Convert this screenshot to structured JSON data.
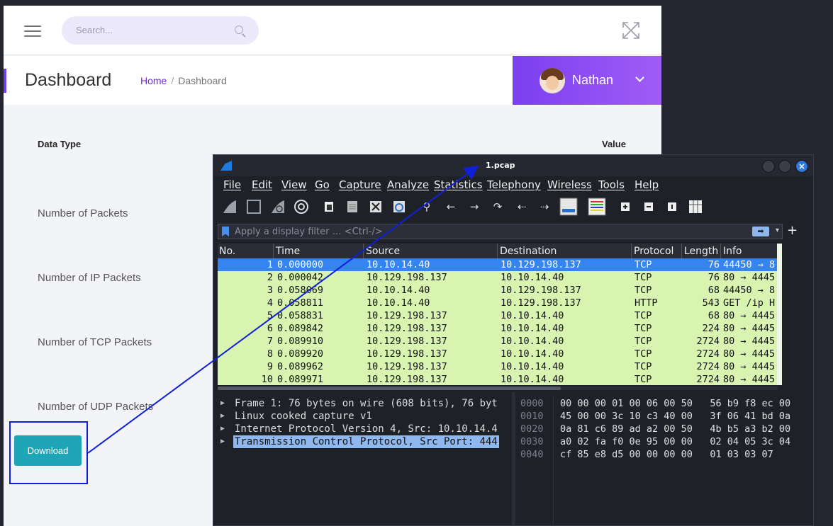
{
  "dashboard": {
    "search_placeholder": "Search...",
    "page_title": "Dashboard",
    "breadcrumb": {
      "home": "Home",
      "separator": "/",
      "current": "Dashboard"
    },
    "user": {
      "name": "Nathan"
    },
    "table": {
      "col_type": "Data Type",
      "col_value": "Value",
      "rows": [
        "Number of Packets",
        "Number of IP Packets",
        "Number of TCP Packets",
        "Number of UDP Packets"
      ]
    },
    "download_label": "Download",
    "colors": {
      "accent": "#6f3ff2",
      "user_gradient_start": "#7b3ff0",
      "download": "#1fa6b6",
      "annotation": "#1020d8"
    }
  },
  "wireshark": {
    "window_title": "1.pcap",
    "menu": [
      "File",
      "Edit",
      "View",
      "Go",
      "Capture",
      "Analyze",
      "Statistics",
      "Telephony",
      "Wireless",
      "Tools",
      "Help"
    ],
    "toolbar_icons": [
      "shark-fin-start-icon",
      "stop-icon",
      "restart-icon",
      "options-gear-icon",
      "open-file-icon",
      "save-file-icon",
      "close-file-icon",
      "reload-icon",
      "find-icon",
      "back-icon",
      "forward-icon",
      "goto-icon",
      "first-icon",
      "last-icon",
      "autoscroll-icon",
      "colorize-icon",
      "zoom-in-icon",
      "zoom-out-icon",
      "normal-size-icon",
      "resize-columns-icon"
    ],
    "filter_placeholder": "Apply a display filter … <Ctrl-/>",
    "columns": [
      "No.",
      "Time",
      "Source",
      "Destination",
      "Protocol",
      "Length",
      "Info"
    ],
    "packets": [
      {
        "no": "1",
        "time": "0.000000",
        "src": "10.10.14.40",
        "dst": "10.129.198.137",
        "proto": "TCP",
        "len": "76",
        "info": "44450 → 8"
      },
      {
        "no": "2",
        "time": "0.000042",
        "src": "10.129.198.137",
        "dst": "10.10.14.40",
        "proto": "TCP",
        "len": "76",
        "info": "80 → 4445"
      },
      {
        "no": "3",
        "time": "0.058069",
        "src": "10.10.14.40",
        "dst": "10.129.198.137",
        "proto": "TCP",
        "len": "68",
        "info": "44450 → 8"
      },
      {
        "no": "4",
        "time": "0.058811",
        "src": "10.10.14.40",
        "dst": "10.129.198.137",
        "proto": "HTTP",
        "len": "543",
        "info": "GET /ip H"
      },
      {
        "no": "5",
        "time": "0.058831",
        "src": "10.129.198.137",
        "dst": "10.10.14.40",
        "proto": "TCP",
        "len": "68",
        "info": "80 → 4445"
      },
      {
        "no": "6",
        "time": "0.089842",
        "src": "10.129.198.137",
        "dst": "10.10.14.40",
        "proto": "TCP",
        "len": "224",
        "info": "80 → 4445"
      },
      {
        "no": "7",
        "time": "0.089910",
        "src": "10.129.198.137",
        "dst": "10.10.14.40",
        "proto": "TCP",
        "len": "2724",
        "info": "80 → 4445"
      },
      {
        "no": "8",
        "time": "0.089920",
        "src": "10.129.198.137",
        "dst": "10.10.14.40",
        "proto": "TCP",
        "len": "2724",
        "info": "80 → 4445"
      },
      {
        "no": "9",
        "time": "0.089962",
        "src": "10.129.198.137",
        "dst": "10.10.14.40",
        "proto": "TCP",
        "len": "2724",
        "info": "80 → 4445"
      },
      {
        "no": "10",
        "time": "0.089971",
        "src": "10.129.198.137",
        "dst": "10.10.14.40",
        "proto": "TCP",
        "len": "2724",
        "info": "80 → 4445"
      }
    ],
    "details": [
      "Frame 1: 76 bytes on wire (608 bits), 76 byt",
      "Linux cooked capture v1",
      "Internet Protocol Version 4, Src: 10.10.14.4",
      "Transmission Control Protocol, Src Port: 444"
    ],
    "hex": [
      {
        "offset": "0000",
        "bytes": "00 00 00 01 00 06 00 50   56 b9 f8 ec 00"
      },
      {
        "offset": "0010",
        "bytes": "45 00 00 3c 10 c3 40 00   3f 06 41 bd 0a"
      },
      {
        "offset": "0020",
        "bytes": "0a 81 c6 89 ad a2 00 50   4b b5 a3 b2 00"
      },
      {
        "offset": "0030",
        "bytes": "a0 02 fa f0 0e 95 00 00   02 04 05 3c 04"
      },
      {
        "offset": "0040",
        "bytes": "cf 85 e8 d5 00 00 00 00   01 03 03 07"
      }
    ],
    "colors": {
      "selected_row": "#3584f0",
      "tcp_row": "#d8f4b0",
      "selected_detail": "#8fb8ee"
    }
  }
}
